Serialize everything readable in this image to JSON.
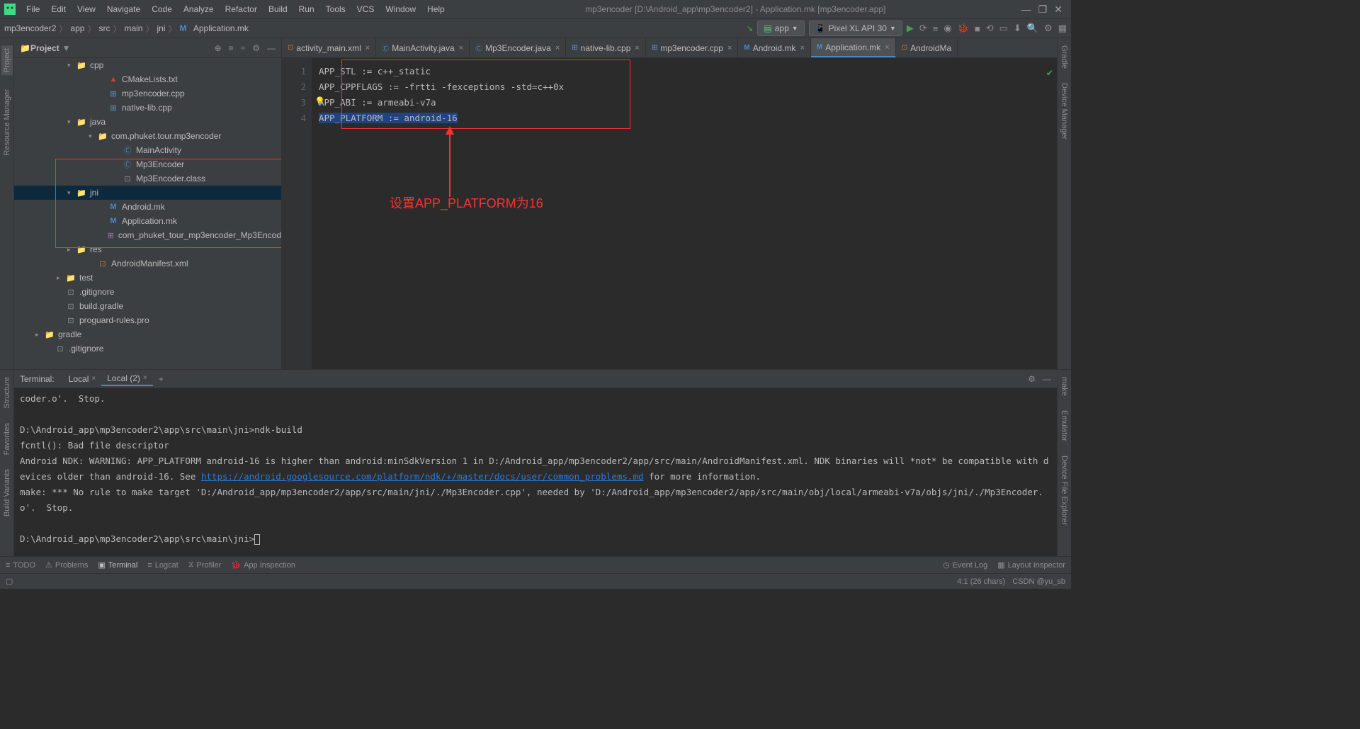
{
  "window_title": "mp3encoder [D:\\Android_app\\mp3encoder2] - Application.mk [mp3encoder.app]",
  "menu": {
    "file": "File",
    "edit": "Edit",
    "view": "View",
    "navigate": "Navigate",
    "code": "Code",
    "analyze": "Analyze",
    "refactor": "Refactor",
    "build": "Build",
    "run": "Run",
    "tools": "Tools",
    "vcs": "VCS",
    "window": "Window",
    "help": "Help"
  },
  "breadcrumb": [
    "mp3encoder2",
    "app",
    "src",
    "main",
    "jni",
    "Application.mk"
  ],
  "run_config": "app",
  "device": "Pixel XL API 30",
  "project_panel_title": "Project",
  "tree": {
    "cpp": "cpp",
    "cmake": "CMakeLists.txt",
    "mp3cpp": "mp3encoder.cpp",
    "nativecpp": "native-lib.cpp",
    "java": "java",
    "pkg": "com.phuket.tour.mp3encoder",
    "mainactivity": "MainActivity",
    "mp3enc": "Mp3Encoder",
    "mp3class": "Mp3Encoder.class",
    "jni": "jni",
    "androidmk": "Android.mk",
    "appmk": "Application.mk",
    "header": "com_phuket_tour_mp3encoder_Mp3Encod",
    "res": "res",
    "manifest": "AndroidManifest.xml",
    "test": "test",
    "gitignore": ".gitignore",
    "buildgradle": "build.gradle",
    "proguard": "proguard-rules.pro",
    "gradle": "gradle",
    "gitignore2": ".gitignore"
  },
  "tabs": [
    {
      "name": "activity_main.xml",
      "icon": "xml"
    },
    {
      "name": "MainActivity.java",
      "icon": "java"
    },
    {
      "name": "Mp3Encoder.java",
      "icon": "java"
    },
    {
      "name": "native-lib.cpp",
      "icon": "cpp"
    },
    {
      "name": "mp3encoder.cpp",
      "icon": "cpp"
    },
    {
      "name": "Android.mk",
      "icon": "mk"
    },
    {
      "name": "Application.mk",
      "icon": "mk",
      "active": true
    },
    {
      "name": "AndroidMa",
      "icon": "xml"
    }
  ],
  "code": {
    "line1": "APP_STL := c++_static",
    "line2": "APP_CPPFLAGS := -frtti -fexceptions -std=c++0x",
    "line3": "APP_ABI := armeabi-v7a",
    "line4a": "APP_PLATFORM := ",
    "line4b": "android-16"
  },
  "annotation": "设置APP_PLATFORM为16",
  "terminal": {
    "label": "Terminal:",
    "tab1": "Local",
    "tab2": "Local (2)",
    "line1": "coder.o'.  Stop.",
    "line2": "D:\\Android_app\\mp3encoder2\\app\\src\\main\\jni>ndk-build",
    "line3": "fcntl(): Bad file descriptor",
    "line4a": "Android NDK: WARNING: APP_PLATFORM android-16 is higher than android:minSdkVersion 1 in D:/Android_app/mp3encoder2/app/src/main/AndroidManifest.xml. NDK binaries will *not* be compatible with devices older than android-16. See ",
    "line4link": "https://android.googlesource.com/platform/ndk/+/master/docs/user/common_problems.md",
    "line4b": " for more information.",
    "line5": "make: *** No rule to make target 'D:/Android_app/mp3encoder2/app/src/main/jni/./Mp3Encoder.cpp', needed by 'D:/Android_app/mp3encoder2/app/src/main/obj/local/armeabi-v7a/objs/jni/./Mp3Encoder.o'.  Stop.",
    "prompt": "D:\\Android_app\\mp3encoder2\\app\\src\\main\\jni>"
  },
  "bottom": {
    "todo": "TODO",
    "problems": "Problems",
    "terminal": "Terminal",
    "logcat": "Logcat",
    "profiler": "Profiler",
    "appinsp": "App Inspection",
    "eventlog": "Event Log",
    "layoutinsp": "Layout Inspector"
  },
  "status": {
    "pos": "4:1 (26 chars)",
    "watermark": "CSDN @yu_sb"
  },
  "sidebar": {
    "project": "Project",
    "resmgr": "Resource Manager",
    "structure": "Structure",
    "favorites": "Favorites",
    "buildvar": "Build Variants",
    "gradle": "Gradle",
    "devmgr": "Device Manager",
    "make": "make",
    "emulator": "Emulator",
    "devfile": "Device File Explorer"
  }
}
